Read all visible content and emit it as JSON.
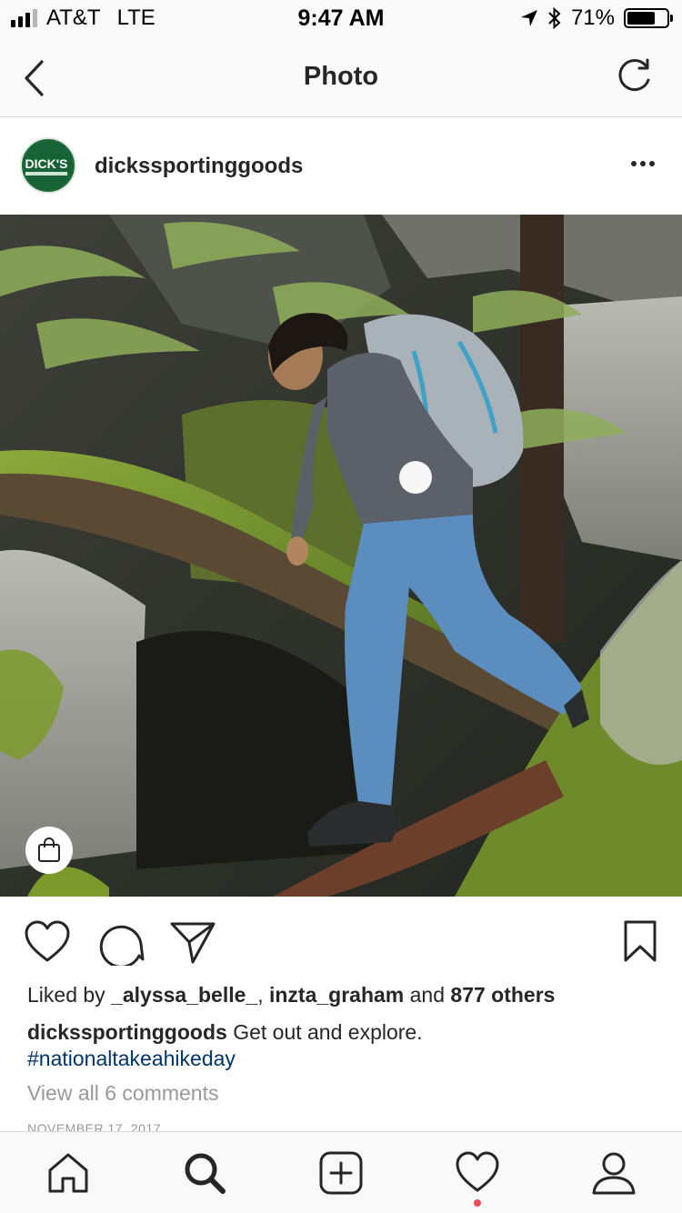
{
  "status_bar": {
    "carrier": "AT&T",
    "network": "LTE",
    "time": "9:47 AM",
    "battery_percent": "71%",
    "battery_level": 0.71,
    "signal_bars_filled": 3,
    "signal_bars_total": 4
  },
  "nav": {
    "title": "Photo",
    "back_icon": "chevron-left-icon",
    "refresh_icon": "refresh-icon"
  },
  "post": {
    "username": "dickssportinggoods",
    "avatar_text": "DICK'S",
    "likes": {
      "prefix": "Liked by",
      "user1": "_alyssa_belle_",
      "separator": ",",
      "user2": "inzta_graham",
      "conjunction": "and",
      "others": "877 others"
    },
    "caption_user": "dickssportinggoods",
    "caption_text": "Get out and explore.",
    "hashtag": "#nationaltakeahikeday",
    "view_comments": "View all 6 comments",
    "date": "NOVEMBER 17, 2017"
  },
  "colors": {
    "text": "#262626",
    "muted": "#999999",
    "hashtag": "#003569",
    "notification": "#ed4956",
    "bar_bg": "#f9f9f9"
  },
  "tab_bar": {
    "items": [
      "home-icon",
      "search-icon",
      "new-post-icon",
      "activity-heart-icon",
      "profile-icon"
    ],
    "active": "search-icon"
  }
}
